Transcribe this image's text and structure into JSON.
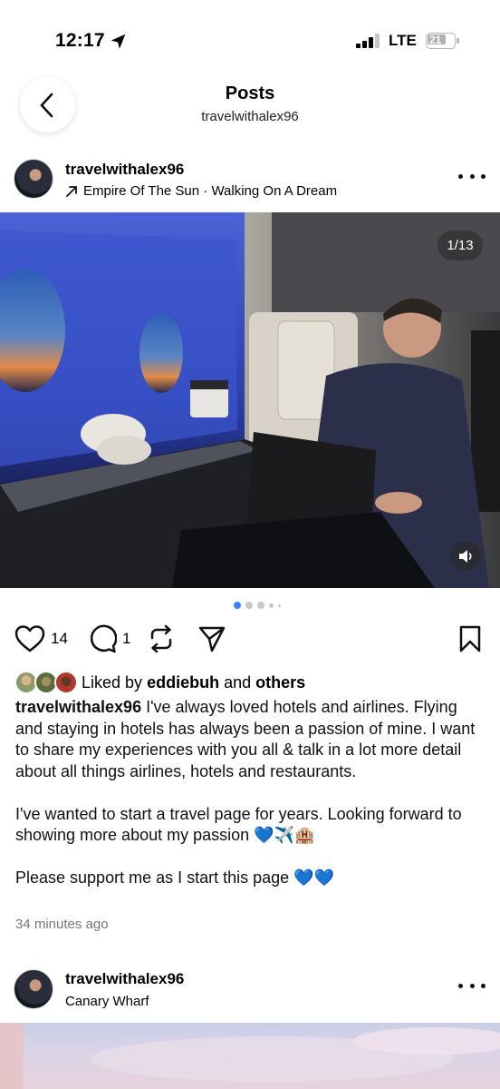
{
  "status_bar": {
    "time": "12:17",
    "network": "LTE",
    "battery": "21"
  },
  "nav": {
    "title": "Posts",
    "subtitle": "travelwithalex96"
  },
  "post": {
    "author": "travelwithalex96",
    "music": "Empire Of The Sun · Walking On A Dream",
    "counter": "1/13",
    "likes_count": "14",
    "comments_count": "1",
    "liked_by_prefix": "Liked by",
    "liked_by_user": "eddiebuh",
    "liked_by_and": "and",
    "liked_by_others": "others",
    "caption_username": "travelwithalex96",
    "caption_p1": "I've always loved hotels and airlines. Flying and staying in hotels has always been a passion of mine. I want to share my experiences with you all & talk in a lot more detail about all things airlines, hotels and restaurants.",
    "caption_p2": "I've wanted to start a travel page for years. Looking forward to showing more about my passion 💙✈️🏨",
    "caption_p3": "Please support me as I start this page 💙💙",
    "timestamp": "34 minutes ago"
  },
  "post2": {
    "author": "travelwithalex96",
    "location": "Canary Wharf"
  },
  "icons": [
    "location-arrow-icon",
    "signal-icon",
    "battery-icon",
    "back-chevron-icon",
    "music-arrow-icon",
    "more-icon",
    "sound-icon",
    "heart-icon",
    "comment-icon",
    "repost-icon",
    "share-icon",
    "bookmark-icon"
  ],
  "colors": {
    "accent_dot": "#3d82f6",
    "heart_blue": "#3b6fd6"
  }
}
